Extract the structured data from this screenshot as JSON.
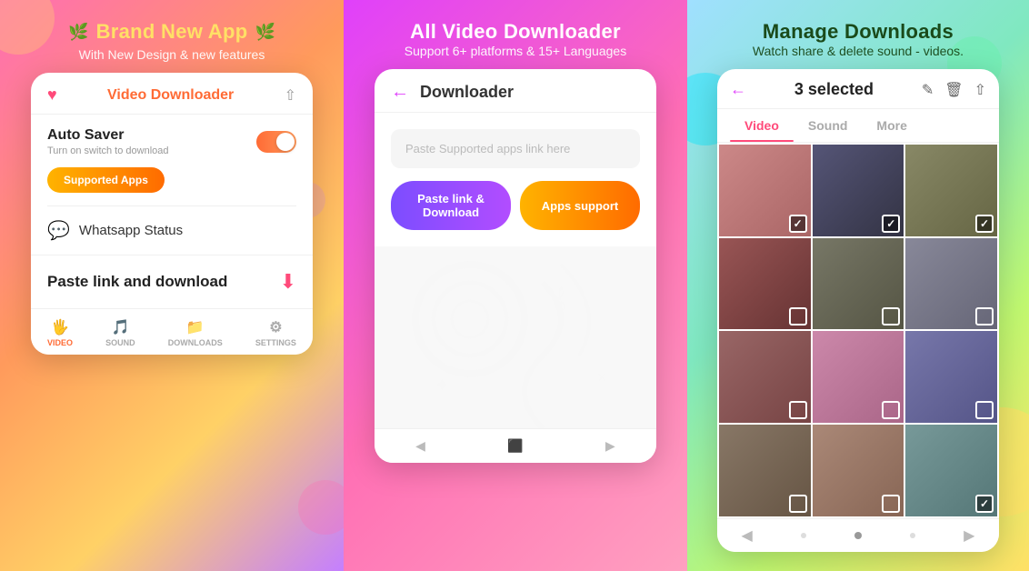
{
  "panel1": {
    "badge": "Brand New App",
    "subtitle": "With New Design & new features",
    "app_title": "Video",
    "app_title_accent": "Downloader",
    "auto_saver_label": "Auto Saver",
    "auto_saver_sub": "Turn on switch to download",
    "supported_apps_btn": "Supported Apps",
    "whatsapp_label": "Whatsapp Status",
    "paste_link_label": "Paste link and download",
    "nav_video": "VIDEO",
    "nav_sound": "SOUND",
    "nav_downloads": "DOWNLOADS",
    "nav_settings": "SETTINGS"
  },
  "panel2": {
    "headline": "All Video Downloader",
    "subtitle": "Support 6+ platforms & 15+ Languages",
    "screen_title": "Downloader",
    "url_placeholder": "Paste Supported apps link here",
    "paste_btn": "Paste link & Download",
    "apps_btn": "Apps support"
  },
  "panel3": {
    "headline": "Manage Downloads",
    "subtitle": "Watch share & delete sound - videos.",
    "selected_count": "3 selected",
    "tab_video": "Video",
    "tab_sound": "Sound",
    "tab_more": "More"
  }
}
